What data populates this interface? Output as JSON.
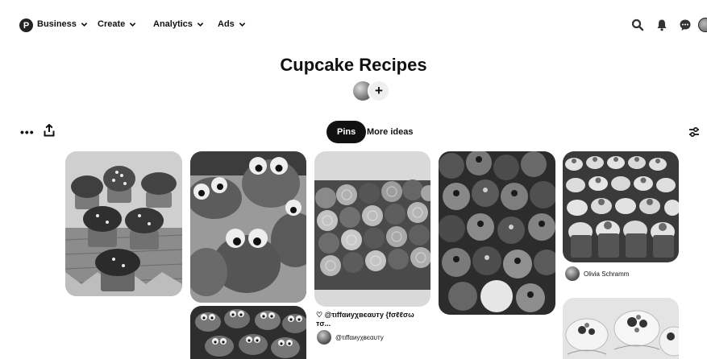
{
  "nav": {
    "logo": "P",
    "items": [
      {
        "label": "Business"
      },
      {
        "label": "Create"
      },
      {
        "label": "Analytics"
      },
      {
        "label": "Ads"
      }
    ],
    "icons": [
      "search-icon",
      "notifications-bell-icon",
      "messages-icon",
      "profile-avatar"
    ]
  },
  "board": {
    "title": "Cupcake Recipes",
    "add_collaborator": "+"
  },
  "actions": {
    "more": "•••",
    "tabs": [
      {
        "label": "Pins",
        "active": true
      },
      {
        "label": "More ideas",
        "active": false
      }
    ]
  },
  "pins": [
    {
      "name": "succulent-cupcakes",
      "caption": "",
      "user": ""
    },
    {
      "name": "cookie-monster-cupcakes",
      "caption": "",
      "user": ""
    },
    {
      "name": "rose-cupcakes",
      "caption": "♡ @τιffαиуχвєαυту {fσℓℓσω тσ...",
      "user": "@τιffαиуχвєαυту"
    },
    {
      "name": "berry-cupcakes",
      "caption": "",
      "user": ""
    },
    {
      "name": "strawberry-cupcakes",
      "caption": "",
      "user": "Olivia Schramm"
    },
    {
      "name": "cookie-monster-cupcakes-2",
      "caption": "",
      "user": ""
    },
    {
      "name": "fruit-tart-cupcakes",
      "caption": "",
      "user": ""
    }
  ],
  "colors": {
    "text": "#111111",
    "tab_active_bg": "#111111",
    "tab_active_text": "#ffffff",
    "collab_add_bg": "#efefef"
  }
}
